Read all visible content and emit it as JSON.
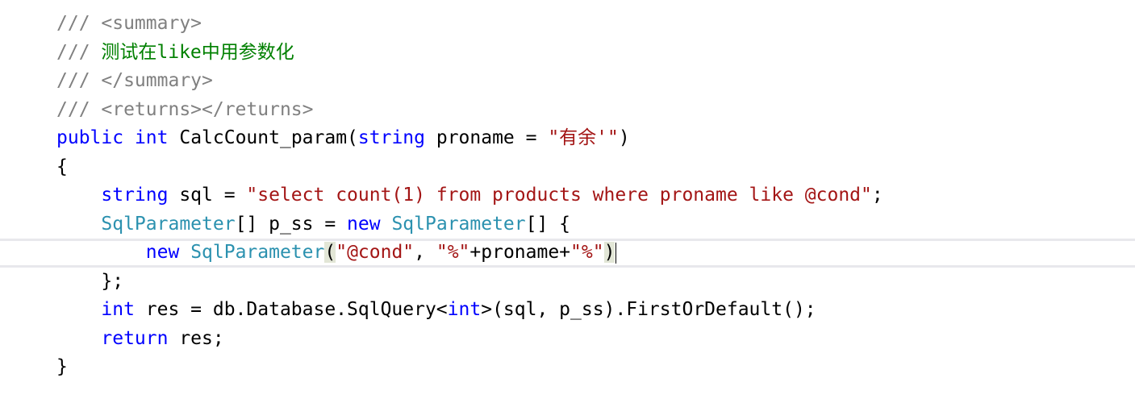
{
  "editor": {
    "language": "C#",
    "colors": {
      "comment": "#808080",
      "comment_text": "#008000",
      "keyword": "#0000ff",
      "type": "#2b91af",
      "string": "#a31515",
      "plain": "#000000",
      "current_line_border": "#e8e8ec",
      "brace_highlight": "#e2e6d6"
    },
    "lines": [
      {
        "indent": "",
        "tokens": [
          {
            "k": "cmt",
            "t": "/// "
          },
          {
            "k": "cmt",
            "t": "<summary>"
          }
        ]
      },
      {
        "indent": "",
        "tokens": [
          {
            "k": "cmt",
            "t": "/// "
          },
          {
            "k": "cmt-text",
            "t": "测试在like中用参数化"
          }
        ]
      },
      {
        "indent": "",
        "tokens": [
          {
            "k": "cmt",
            "t": "/// "
          },
          {
            "k": "cmt",
            "t": "</summary>"
          }
        ]
      },
      {
        "indent": "",
        "tokens": [
          {
            "k": "cmt",
            "t": "/// "
          },
          {
            "k": "cmt",
            "t": "<returns></returns>"
          }
        ]
      },
      {
        "indent": "",
        "tokens": [
          {
            "k": "kw",
            "t": "public"
          },
          {
            "k": "plain",
            "t": " "
          },
          {
            "k": "kw",
            "t": "int"
          },
          {
            "k": "plain",
            "t": " CalcCount_param("
          },
          {
            "k": "kw",
            "t": "string"
          },
          {
            "k": "plain",
            "t": " proname = "
          },
          {
            "k": "str",
            "t": "\"有余'\""
          },
          {
            "k": "plain",
            "t": ")"
          }
        ]
      },
      {
        "indent": "",
        "tokens": [
          {
            "k": "plain",
            "t": "{"
          }
        ]
      },
      {
        "indent": "    ",
        "tokens": [
          {
            "k": "kw",
            "t": "string"
          },
          {
            "k": "plain",
            "t": " sql = "
          },
          {
            "k": "str",
            "t": "\"select count(1) from products where proname like @cond\""
          },
          {
            "k": "plain",
            "t": ";"
          }
        ]
      },
      {
        "indent": "    ",
        "tokens": [
          {
            "k": "type",
            "t": "SqlParameter"
          },
          {
            "k": "plain",
            "t": "[] p_ss = "
          },
          {
            "k": "kw",
            "t": "new"
          },
          {
            "k": "plain",
            "t": " "
          },
          {
            "k": "type",
            "t": "SqlParameter"
          },
          {
            "k": "plain",
            "t": "[] {"
          }
        ]
      },
      {
        "indent": "        ",
        "current": true,
        "tokens": [
          {
            "k": "kw",
            "t": "new"
          },
          {
            "k": "plain",
            "t": " "
          },
          {
            "k": "type",
            "t": "SqlParameter"
          },
          {
            "k": "plain brace-hl",
            "t": "("
          },
          {
            "k": "str",
            "t": "\"@cond\""
          },
          {
            "k": "plain",
            "t": ", "
          },
          {
            "k": "str",
            "t": "\"%\""
          },
          {
            "k": "plain",
            "t": "+proname+"
          },
          {
            "k": "str",
            "t": "\"%\""
          },
          {
            "k": "plain brace-hl",
            "t": ")"
          }
        ]
      },
      {
        "indent": "    ",
        "tokens": [
          {
            "k": "plain",
            "t": "};"
          }
        ]
      },
      {
        "indent": "    ",
        "tokens": [
          {
            "k": "kw",
            "t": "int"
          },
          {
            "k": "plain",
            "t": " res = db.Database.SqlQuery<"
          },
          {
            "k": "kw",
            "t": "int"
          },
          {
            "k": "plain",
            "t": ">(sql, p_ss).FirstOrDefault();"
          }
        ]
      },
      {
        "indent": "    ",
        "tokens": [
          {
            "k": "kw",
            "t": "return"
          },
          {
            "k": "plain",
            "t": " res;"
          }
        ]
      },
      {
        "indent": "",
        "tokens": [
          {
            "k": "plain",
            "t": "}"
          }
        ]
      }
    ]
  }
}
